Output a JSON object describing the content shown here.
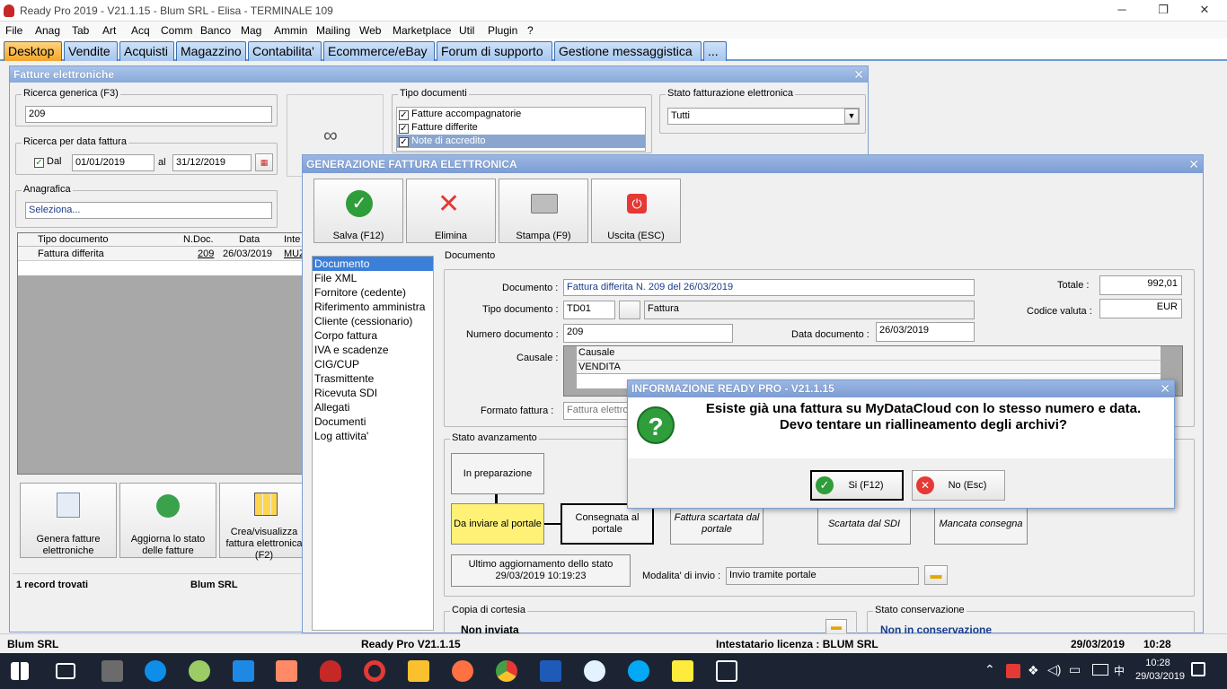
{
  "app": {
    "title": "Ready Pro 2019 - V21.1.15 - Blum SRL - Elisa - TERMINALE 109"
  },
  "menu": [
    "File",
    "Anag",
    "Tab",
    "Art",
    "Acq",
    "Comm",
    "Banco",
    "Mag",
    "Ammin",
    "Mailing",
    "Web",
    "Marketplace",
    "Util",
    "Plugin",
    "?"
  ],
  "tabs": [
    "Desktop",
    "Vendite",
    "Acquisti",
    "Magazzino",
    "Contabilita'",
    "Ecommerce/eBay",
    "Forum di supporto",
    "Gestione messaggistica",
    "..."
  ],
  "fatture": {
    "title": "Fatture elettroniche",
    "ricerca_label": "Ricerca generica (F3)",
    "ricerca_value": "209",
    "data_label": "Ricerca per data fattura",
    "dal_label": "Dal",
    "dal_value": "01/01/2019",
    "al_label": "al",
    "al_value": "31/12/2019",
    "anagrafica_label": "Anagrafica",
    "anagrafica_value": "Seleziona...",
    "tipo_label": "Tipo documenti",
    "tipo_items": [
      "Fatture accompagnatorie",
      "Fatture differite",
      "Note di accredito"
    ],
    "stato_label": "Stato fatturazione elettronica",
    "stato_value": "Tutti",
    "grid_headers": [
      "Tipo documento",
      "N.Doc.",
      "Data",
      "Inte"
    ],
    "grid_row": [
      "Fattura differita",
      "209",
      "26/03/2019",
      "MUZ"
    ],
    "actions": [
      "Genera fatture elettroniche",
      "Aggiorna lo stato delle fatture",
      "Crea/visualizza fattura elettronica (F2)"
    ],
    "records": "1 record trovati",
    "company": "Blum SRL"
  },
  "gen": {
    "title": "GENERAZIONE FATTURA ELETTRONICA",
    "toolbar": [
      "Salva (F12)",
      "Elimina",
      "Stampa (F9)",
      "Uscita (ESC)"
    ],
    "nav": [
      "Documento",
      "File XML",
      "Fornitore (cedente)",
      "Riferimento amministra",
      "Cliente (cessionario)",
      "Corpo fattura",
      "IVA e scadenze",
      "CIG/CUP",
      "Trasmittente",
      "Ricevuta SDI",
      "Allegati",
      "Documenti",
      "Log attivita'"
    ],
    "doc_group": "Documento",
    "documento_label": "Documento :",
    "documento_value": "Fattura differita N. 209 del 26/03/2019",
    "tipo_label": "Tipo documento :",
    "tipo_code": "TD01",
    "tipo_desc": "Fattura",
    "numero_label": "Numero documento :",
    "numero_value": "209",
    "data_label": "Data documento :",
    "data_value": "26/03/2019",
    "totale_label": "Totale :",
    "totale_value": "992,01",
    "valuta_label": "Codice valuta :",
    "valuta_value": "EUR",
    "causale_label": "Causale :",
    "causale_header": "Causale",
    "causale_value": "VENDITA",
    "formato_label": "Formato fattura :",
    "formato_value": "Fattura elettro",
    "stato_group": "Stato avanzamento",
    "stati": [
      "In preparazione",
      "Da inviare al portale",
      "Consegnata al portale",
      "Fattura scartata dal portale",
      "Scartata dal SDI",
      "Mancata consegna"
    ],
    "ultimo_label": "Ultimo aggiornamento dello stato",
    "ultimo_value": "29/03/2019 10:19:23",
    "modalita_label": "Modalita' di invio :",
    "modalita_value": "Invio tramite portale",
    "copia_group": "Copia di cortesia",
    "copia_value": "Non inviata",
    "cons_group": "Stato conservazione",
    "cons_value": "Non in conservazione"
  },
  "dialog": {
    "title": "INFORMAZIONE READY PRO - V21.1.15",
    "line1": "Esiste già una fattura su MyDataCloud con lo stesso numero e data.",
    "line2": "Devo tentare un riallineamento degli archivi?",
    "yes": "Si (F12)",
    "no": "No (Esc)"
  },
  "statusbar": {
    "company": "Blum SRL",
    "version": "Ready Pro V21.1.15",
    "license": "Intestatario licenza : BLUM SRL",
    "date": "29/03/2019",
    "time": "10:28"
  },
  "tray": {
    "time": "10:28",
    "date": "29/03/2019"
  },
  "colors": {
    "accent": "#3c7fd9",
    "highlight": "#fff176",
    "tab_active": "#f3a62c"
  }
}
